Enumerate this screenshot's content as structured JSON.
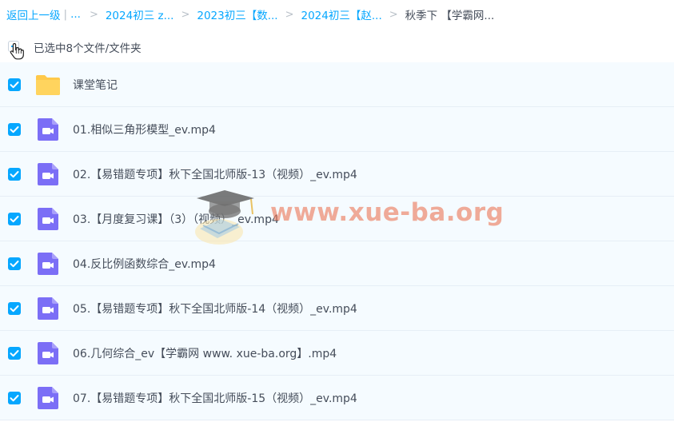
{
  "breadcrumb": {
    "back_label": "返回上一级",
    "separator": "|",
    "ellipsis": "...",
    "arrow": ">",
    "items": [
      {
        "label": "2024初三 z..."
      },
      {
        "label": "2023初三【数..."
      },
      {
        "label": "2024初三【赵..."
      }
    ],
    "current": "秋季下 【学霸网..."
  },
  "selection": {
    "text": "已选中8个文件/文件夹",
    "state": "partial"
  },
  "files": [
    {
      "name": "课堂笔记",
      "type": "folder",
      "checked": true
    },
    {
      "name": "01.相似三角形模型_ev.mp4",
      "type": "video",
      "checked": true
    },
    {
      "name": "02.【易错题专项】秋下全国北师版-13（视频）_ev.mp4",
      "type": "video",
      "checked": true
    },
    {
      "name": "03.【月度复习课】（3）（视频）_ev.mp4",
      "type": "video",
      "checked": true
    },
    {
      "name": "04.反比例函数综合_ev.mp4",
      "type": "video",
      "checked": true
    },
    {
      "name": "05.【易错题专项】秋下全国北师版-14（视频）_ev.mp4",
      "type": "video",
      "checked": true
    },
    {
      "name": "06.几何综合_ev【学霸网 www. xue-ba.org】.mp4",
      "type": "video",
      "checked": true
    },
    {
      "name": "07.【易错题专项】秋下全国北师版-15（视频）_ev.mp4",
      "type": "video",
      "checked": true
    }
  ],
  "watermark": {
    "text": "www.xue-ba.org"
  },
  "colors": {
    "accent": "#06a7ff",
    "row_bg": "#f5fbff",
    "folder": "#ffc94a",
    "video_icon": "#7b6ef6",
    "text": "#454d5a"
  },
  "icons": {
    "folder": "folder-icon",
    "video": "video-file-icon",
    "check": "checkmark-icon",
    "cursor": "hand-cursor-icon"
  }
}
